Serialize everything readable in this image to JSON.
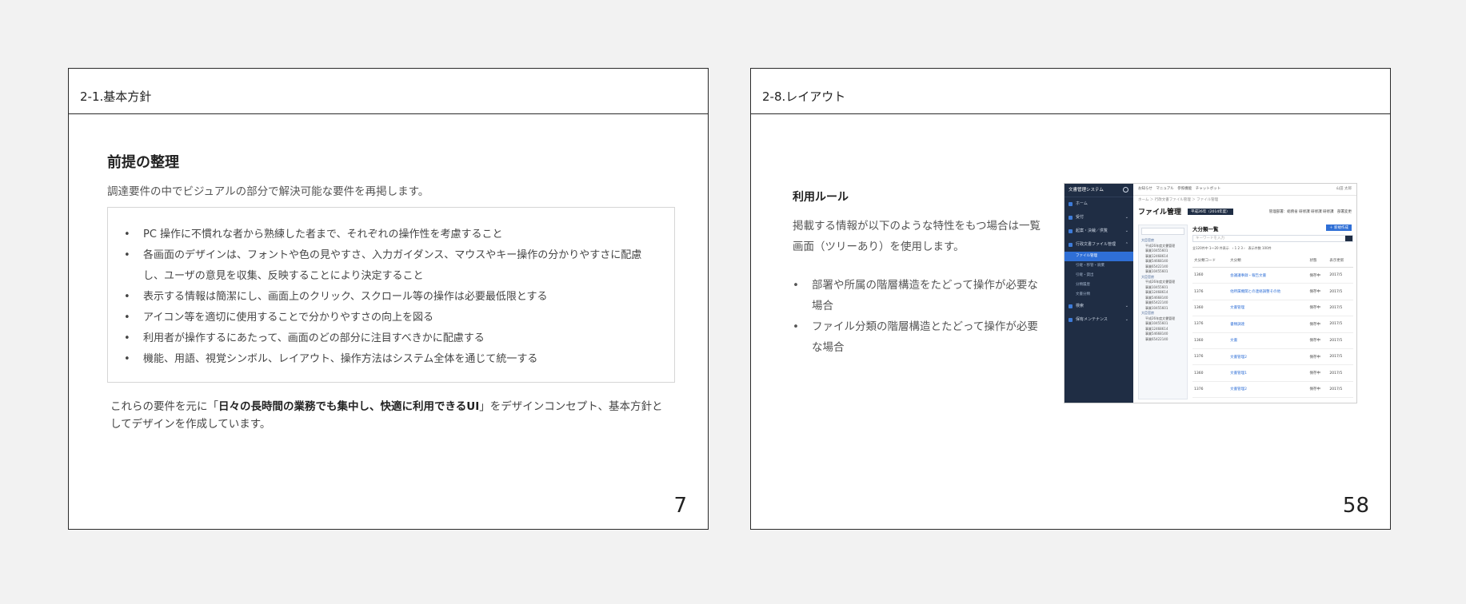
{
  "slide1": {
    "header": "2-1.基本方針",
    "heading": "前提の整理",
    "subtitle": "調達要件の中でビジュアルの部分で解決可能な要件を再掲します。",
    "bullets": [
      "PC 操作に不慣れな者から熟練した者まで、それぞれの操作性を考慮すること",
      "各画面のデザインは、フォントや色の見やすさ、入力ガイダンス、マウスやキー操作の分かりやすさに配慮し、ユーザの意見を収集、反映することにより決定すること",
      "表示する情報は簡潔にし、画面上のクリック、スクロール等の操作は必要最低限とする",
      "アイコン等を適切に使用することで分かりやすさの向上を図る",
      "利用者が操作するにあたって、画面のどの部分に注目すべきかに配慮する",
      "機能、用語、視覚シンボル、レイアウト、操作方法はシステム全体を通じて統一する"
    ],
    "footer_pre": "これらの要件を元に「",
    "footer_bold": "日々の長時間の業務でも集中し、快適に利用できるUI",
    "footer_post": "」をデザインコンセプト、基本方針としてデザインを作成しています。",
    "page_number": "7"
  },
  "slide2": {
    "header": "2-8.レイアウト",
    "heading": "利用ルール",
    "description": "掲載する情報が以下のような特性をもつ場合は一覧画面（ツリーあり）を使用します。",
    "bullets": [
      "部署や所属の階層構造をたどって操作が必要な場合",
      "ファイル分類の階層構造とたどって操作が必要な場合"
    ],
    "page_number": "58",
    "screenshot": {
      "app_title": "文書管理システム",
      "nav": [
        {
          "label": "ホーム",
          "chevron": ""
        },
        {
          "label": "受付",
          "chevron": "⌄"
        },
        {
          "label": "起案・決裁／供覧",
          "chevron": "⌄"
        },
        {
          "label": "行政文書ファイル管理",
          "chevron": "⌃"
        }
      ],
      "subnav": [
        "ファイル管理",
        "引継・移管・廃棄",
        "引継・貸出",
        "分類履歴",
        "文書分類"
      ],
      "nav_bottom": [
        {
          "label": "検索",
          "chevron": "⌄"
        },
        {
          "label": "保有メンテナンス",
          "chevron": "⌄"
        }
      ],
      "topbar": "お知らせ　マニュアル　参照機能　チャットボット",
      "topbar_right": "山田 太郎",
      "breadcrumb": "ホーム ＞ 行政文書ファイル管理 ＞ ファイル管理",
      "page_title": "ファイル管理",
      "year": "平成26年（2014年度）",
      "manager": "管理部署：総務省 研修課 研修課 研修課　部署変更",
      "tree_nodes": [
        {
          "label": "大臣官房",
          "level": 1
        },
        {
          "label": "平成26年度文書管理",
          "level": 2
        },
        {
          "label": "事業10455601",
          "level": 2
        },
        {
          "label": "事業12468614",
          "level": 2
        },
        {
          "label": "事業54668140",
          "level": 2
        },
        {
          "label": "事業65422140",
          "level": 2
        },
        {
          "label": "事業10455601",
          "level": 2
        },
        {
          "label": "大臣官房",
          "level": 1
        },
        {
          "label": "平成26年度文書管理",
          "level": 2
        },
        {
          "label": "事業10455601",
          "level": 2
        },
        {
          "label": "事業12468614",
          "level": 2
        },
        {
          "label": "事業54668140",
          "level": 2
        },
        {
          "label": "事業65422140",
          "level": 2
        },
        {
          "label": "事業10455601",
          "level": 2
        },
        {
          "label": "大臣官房",
          "level": 1
        },
        {
          "label": "平成26年度文書管理",
          "level": 2
        },
        {
          "label": "事業10455601",
          "level": 2
        },
        {
          "label": "事業12468614",
          "level": 2
        },
        {
          "label": "事業54668140",
          "level": 2
        },
        {
          "label": "事業65422140",
          "level": 2
        }
      ],
      "list_title": "大分類一覧",
      "new_button": "＋ 新規作成",
      "keyword_placeholder": "キーワードを入力",
      "pager": "全120件中 1〜20 件表示　‹ 1 2 3 ›　表示件数 100件",
      "columns": [
        "大分類コード",
        "大分類",
        "状態",
        "表示更新"
      ],
      "rows": [
        [
          "1360",
          "会議議事録・報告文書",
          "保存中",
          "2017/5"
        ],
        [
          "1376",
          "他所属機関との連絡調整その他",
          "保存中",
          "2017/5"
        ],
        [
          "1360",
          "文書管理",
          "保存中",
          "2017/5"
        ],
        [
          "1376",
          "書類調達",
          "保存中",
          "2017/5"
        ],
        [
          "1360",
          "文書",
          "保存中",
          "2017/5"
        ],
        [
          "1376",
          "文書管理2",
          "保存中",
          "2017/5"
        ],
        [
          "1360",
          "文書管理1",
          "保存中",
          "2017/5"
        ],
        [
          "1376",
          "文書管理2",
          "保存中",
          "2017/5"
        ],
        [
          "1360",
          "文書管理3",
          "保存中",
          "2017/5"
        ]
      ]
    }
  }
}
